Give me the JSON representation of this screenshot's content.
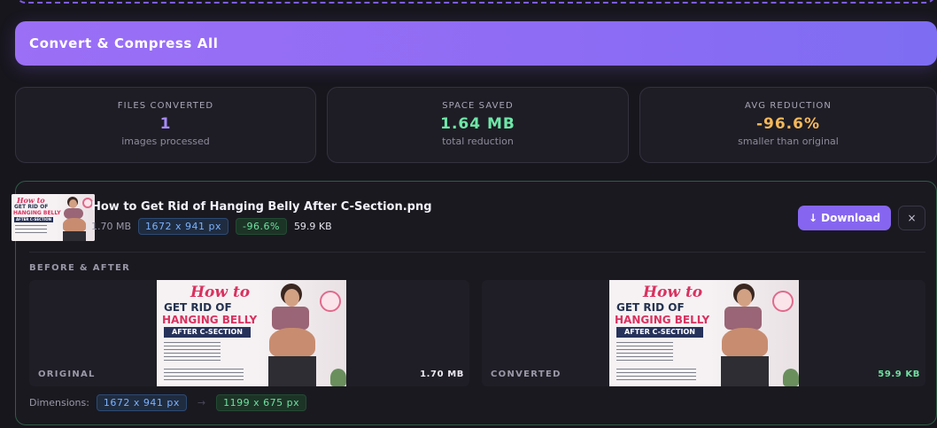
{
  "actions": {
    "convert_label": "Convert & Compress All"
  },
  "stats": {
    "files": {
      "label": "FILES CONVERTED",
      "value": "1",
      "sub": "images processed",
      "color": "#a78bfa"
    },
    "space": {
      "label": "SPACE SAVED",
      "value": "1.64 MB",
      "sub": "total reduction",
      "color": "#6ee7a8"
    },
    "avg": {
      "label": "AVG REDUCTION",
      "value": "-96.6%",
      "sub": "smaller than original",
      "color": "#f5b85a"
    }
  },
  "file": {
    "name": "How to Get Rid of Hanging Belly After C-Section.png",
    "original_size": "1.70 MB",
    "dimensions": "1672 x 941 px",
    "reduction": "-96.6%",
    "new_size": "59.9 KB",
    "download_label": "↓ Download",
    "close_label": "×"
  },
  "comparison": {
    "title": "BEFORE & AFTER",
    "original": {
      "caption": "ORIGINAL",
      "size": "1.70 MB"
    },
    "converted": {
      "caption": "CONVERTED",
      "size": "59.9 KB"
    },
    "dimensions_label": "Dimensions:",
    "dims_original": "1672 x 941 px",
    "dims_separator": "→",
    "dims_converted": "1199 x 675 px"
  },
  "artwork": {
    "line1": "How to",
    "line2": "GET RID OF",
    "line3": "HANGING BELLY",
    "line4": "AFTER C-SECTION"
  },
  "colors": {
    "accent": "#8666f0",
    "success": "#6fe0a0",
    "info": "#7ab2ff",
    "panel_border": "#2f5c44"
  }
}
